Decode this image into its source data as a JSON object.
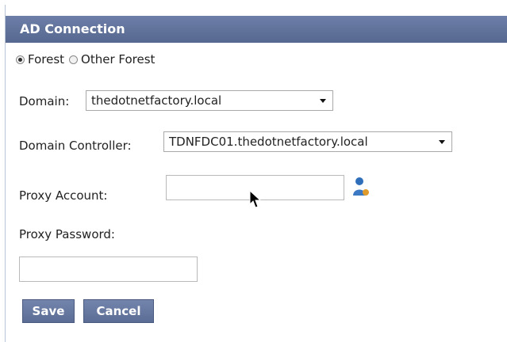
{
  "panel": {
    "title": "AD Connection"
  },
  "radios": [
    {
      "label": "Forest",
      "checked": true
    },
    {
      "label": "Other Forest",
      "checked": false
    }
  ],
  "domain": {
    "label": "Domain:",
    "value": "thedotnetfactory.local"
  },
  "domain_controller": {
    "label": "Domain Controller:",
    "value": "TDNFDC01.thedotnetfactory.local"
  },
  "proxy_account": {
    "label": "Proxy Account:",
    "value": "",
    "icon": "user-lookup-icon"
  },
  "proxy_password": {
    "label": "Proxy Password:",
    "value": ""
  },
  "buttons": {
    "save": "Save",
    "cancel": "Cancel"
  },
  "colors": {
    "header_bg": "#5f7199",
    "button_bg": "#6477a0"
  }
}
